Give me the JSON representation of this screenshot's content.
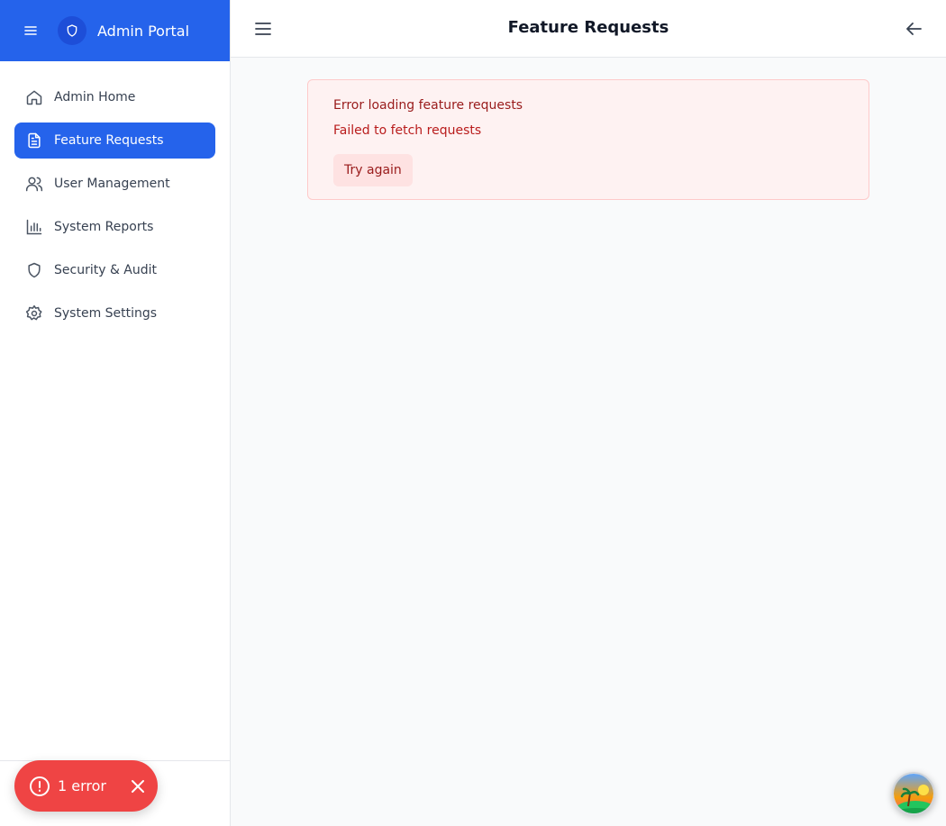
{
  "app": {
    "brand_name": "Admin Portal",
    "accent_color": "#2563eb"
  },
  "sidebar": {
    "items": [
      {
        "label": "Admin Home",
        "icon": "home-icon",
        "active": false
      },
      {
        "label": "Feature Requests",
        "icon": "document-icon",
        "active": true
      },
      {
        "label": "User Management",
        "icon": "users-icon",
        "active": false
      },
      {
        "label": "System Reports",
        "icon": "bar-chart-icon",
        "active": false
      },
      {
        "label": "Security & Audit",
        "icon": "shield-icon",
        "active": false
      },
      {
        "label": "System Settings",
        "icon": "gear-icon",
        "active": false
      }
    ]
  },
  "header": {
    "title": "Feature Requests"
  },
  "error": {
    "title": "Error loading feature requests",
    "message": "Failed to fetch requests",
    "retry_label": "Try again",
    "color": "#991b1b"
  },
  "toast": {
    "label": "1 error",
    "color": "#ef4444"
  }
}
